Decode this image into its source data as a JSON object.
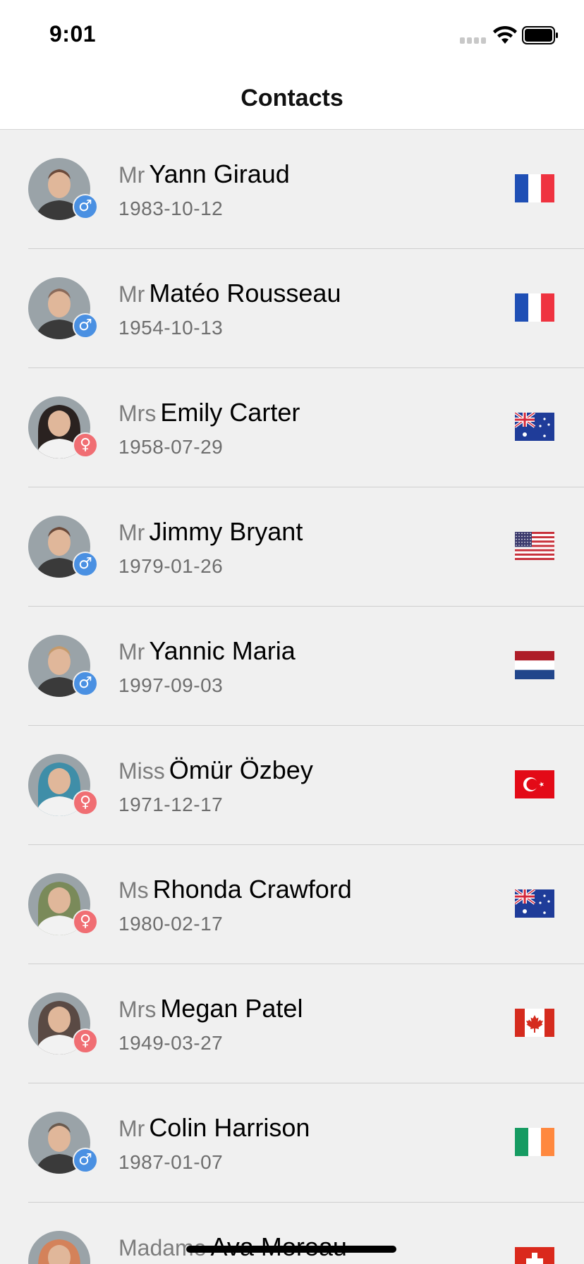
{
  "status_bar": {
    "time": "9:01",
    "signal_icon": "cellular-signal-icon",
    "wifi_icon": "wifi-icon",
    "battery_icon": "battery-icon"
  },
  "nav": {
    "title": "Contacts"
  },
  "colors": {
    "male_badge": "#4a90e2",
    "female_badge": "#f06e73",
    "background": "#f0f0f0"
  },
  "contacts": [
    {
      "title": "Mr",
      "name": "Yann Giraud",
      "dob": "1983-10-12",
      "gender": "male",
      "gender_symbol": "♂",
      "flag": "France",
      "flag_icon": "flag-france-icon",
      "avatar_tone": "#6b4a3a"
    },
    {
      "title": "Mr",
      "name": "Matéo Rousseau",
      "dob": "1954-10-13",
      "gender": "male",
      "gender_symbol": "♂",
      "flag": "France",
      "flag_icon": "flag-france-icon",
      "avatar_tone": "#8a6a5a"
    },
    {
      "title": "Mrs",
      "name": "Emily Carter",
      "dob": "1958-07-29",
      "gender": "female",
      "gender_symbol": "♀",
      "flag": "Australia",
      "flag_icon": "flag-australia-icon",
      "avatar_tone": "#2a2220"
    },
    {
      "title": "Mr",
      "name": "Jimmy Bryant",
      "dob": "1979-01-26",
      "gender": "male",
      "gender_symbol": "♂",
      "flag": "United States",
      "flag_icon": "flag-usa-icon",
      "avatar_tone": "#6b4a3a"
    },
    {
      "title": "Mr",
      "name": "Yannic Maria",
      "dob": "1997-09-03",
      "gender": "male",
      "gender_symbol": "♂",
      "flag": "Netherlands",
      "flag_icon": "flag-netherlands-icon",
      "avatar_tone": "#c49a6c"
    },
    {
      "title": "Miss",
      "name": "Ömür Özbey",
      "dob": "1971-12-17",
      "gender": "female",
      "gender_symbol": "♀",
      "flag": "Turkey",
      "flag_icon": "flag-turkey-icon",
      "avatar_tone": "#3f8ea8"
    },
    {
      "title": "Ms",
      "name": "Rhonda Crawford",
      "dob": "1980-02-17",
      "gender": "female",
      "gender_symbol": "♀",
      "flag": "Australia",
      "flag_icon": "flag-australia-icon",
      "avatar_tone": "#7a8a5a"
    },
    {
      "title": "Mrs",
      "name": "Megan Patel",
      "dob": "1949-03-27",
      "gender": "female",
      "gender_symbol": "♀",
      "flag": "Canada",
      "flag_icon": "flag-canada-icon",
      "avatar_tone": "#5a4a44"
    },
    {
      "title": "Mr",
      "name": "Colin Harrison",
      "dob": "1987-01-07",
      "gender": "male",
      "gender_symbol": "♂",
      "flag": "Ireland",
      "flag_icon": "flag-ireland-icon",
      "avatar_tone": "#6a5a4e"
    },
    {
      "title": "Madame",
      "name": "Ava Moreau",
      "dob": "",
      "gender": "female",
      "gender_symbol": "♀",
      "flag": "Switzerland",
      "flag_icon": "flag-switzerland-icon",
      "avatar_tone": "#d4825a"
    }
  ]
}
